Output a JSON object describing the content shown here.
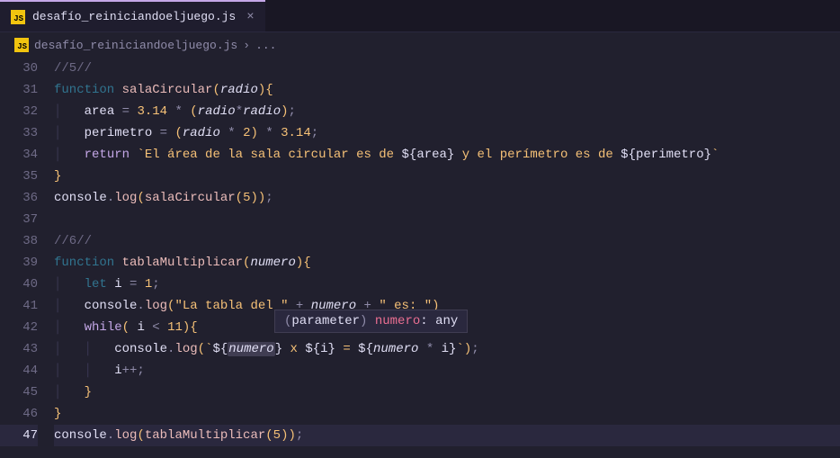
{
  "tab": {
    "filename": "desafío_reiniciandoeljuego.js",
    "close": "×"
  },
  "breadcrumb": {
    "filename": "desafío_reiniciandoeljuego.js",
    "sep": "›",
    "more": "..."
  },
  "lineNumbers": [
    "30",
    "31",
    "32",
    "33",
    "34",
    "35",
    "36",
    "37",
    "38",
    "39",
    "40",
    "41",
    "42",
    "43",
    "44",
    "45",
    "46",
    "47"
  ],
  "tooltip": {
    "open": "(",
    "label": "parameter",
    "close": ") ",
    "param": "numero",
    "colon": ": ",
    "type": "any"
  },
  "tokens": {
    "c5": "//5//",
    "c6": "//6//",
    "fn": "function",
    "ret": "return",
    "let": "let",
    "whi": "while",
    "salaCircular": "salaCircular",
    "tablaMultiplicar": "tablaMultiplicar",
    "radio": "radio",
    "numero": "numero",
    "area": "area",
    "perimetro": "perimetro",
    "i": "i",
    "console": "console",
    "log": "log",
    "n314": "3.14",
    "n2": "2",
    "n5": "5",
    "n1": "1",
    "n11": "11",
    "s_area": "`El área de la sala circular es de ",
    "s_peri": " y el perímetro es de ",
    "s_tabla": "\"La tabla del \"",
    "s_es": "\" es: \"",
    "tick": "`",
    "x": " x ",
    "eq2": " = "
  }
}
